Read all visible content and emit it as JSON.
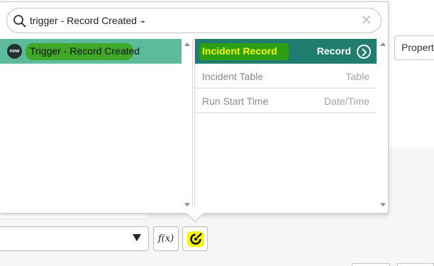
{
  "background": {
    "properties_button_label": "Propert"
  },
  "search": {
    "value": "trigger - Record Created",
    "cursor_glyph": "➛"
  },
  "left_column": {
    "items": [
      {
        "badge": "now",
        "label": "Trigger - Record Created",
        "selected": true
      }
    ]
  },
  "right_column": {
    "items": [
      {
        "label": "Incident Record",
        "type": "Record",
        "selected": true
      },
      {
        "label": "Incident Table",
        "type": "Table",
        "selected": false
      },
      {
        "label": "Run Start Time",
        "type": "Date/Time",
        "selected": false
      }
    ]
  },
  "toolbar": {
    "fx_label": "f(x)"
  },
  "colors": {
    "left_selected": "#5dbb9c",
    "right_selected": "#217c70",
    "highlight_yellow": "#f7f70a",
    "highlight_green": "#3fa829"
  },
  "icons": {
    "search": "magnifier-icon",
    "clear": "close-icon",
    "navigate": "chevron-right-circle-icon",
    "data_pill": "data-pill-icon",
    "dropdown": "caret-down-icon"
  }
}
